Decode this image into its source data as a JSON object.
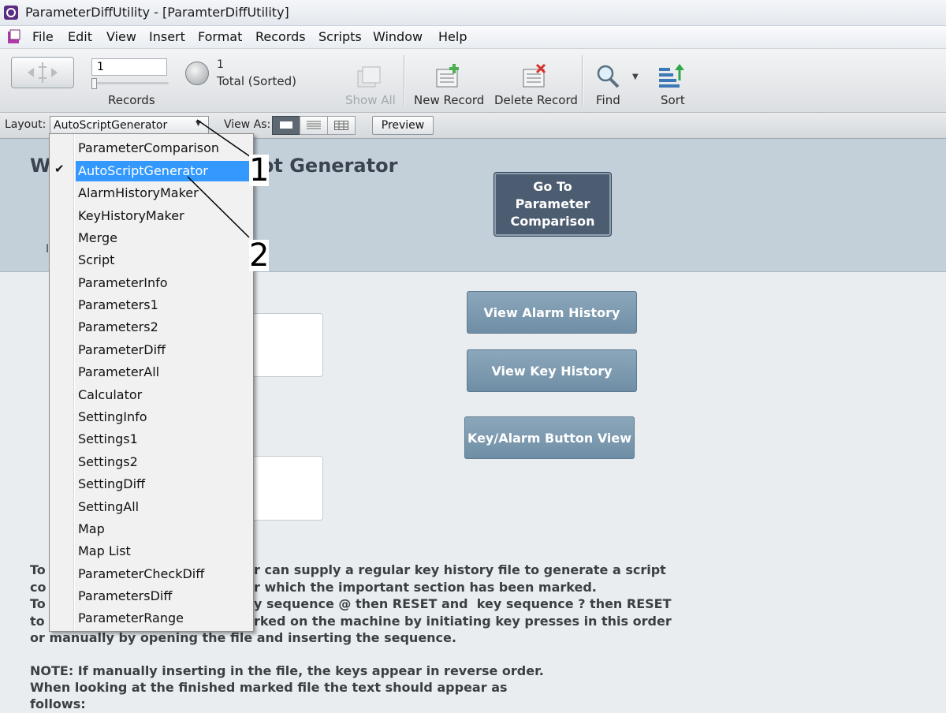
{
  "window": {
    "title": "ParameterDiffUtility - [ParamterDiffUtility]"
  },
  "menu": [
    "File",
    "Edit",
    "View",
    "Insert",
    "Format",
    "Records",
    "Scripts",
    "Window",
    "Help"
  ],
  "toolbar": {
    "record_input": "1",
    "records_label": "Records",
    "count": "1",
    "total_label": "Total (Sorted)",
    "show_all": "Show All",
    "new_record": "New Record",
    "delete_record": "Delete Record",
    "find": "Find",
    "sort": "Sort"
  },
  "layoutbar": {
    "layout_label": "Layout:",
    "layout_value": "AutoScriptGenerator",
    "view_as_label": "View As:",
    "preview": "Preview"
  },
  "dropdown": {
    "items": [
      "ParameterComparison",
      "AutoScriptGenerator",
      "AlarmHistoryMaker",
      "KeyHistoryMaker",
      "Merge",
      "Script",
      "ParameterInfo",
      "Parameters1",
      "Parameters2",
      "ParameterDiff",
      "ParameterAll",
      "Calculator",
      "SettingInfo",
      "Settings1",
      "Settings2",
      "SettingDiff",
      "SettingAll",
      "Map",
      "Map List",
      "ParameterCheckDiff",
      "ParametersDiff",
      "ParameterRange"
    ],
    "selected": "AutoScriptGenerator",
    "check": "✔"
  },
  "content": {
    "heading_start": "W",
    "heading_end": "ipt Generator",
    "go_to_param": "Go To Parameter Comparison",
    "view_alarm": "View Alarm History",
    "view_key": "View Key History",
    "key_alarm": "Key/Alarm Button View",
    "para_left": [
      "To",
      "co",
      "To",
      "to r",
      "or manually by opening the file and inserting the sequence."
    ],
    "para_right": [
      "r can supply a regular key history file to generate a script",
      "r which the important section has been marked.",
      "y sequence @ then RESET and  key sequence ? then RESET",
      "rked on the machine by initiating key presses in this order"
    ],
    "note": [
      "NOTE: If manually inserting in the file, the keys appear in reverse order.",
      "When looking at the finished marked file the text should appear as",
      "follows:"
    ]
  },
  "callouts": [
    "1",
    "2"
  ]
}
